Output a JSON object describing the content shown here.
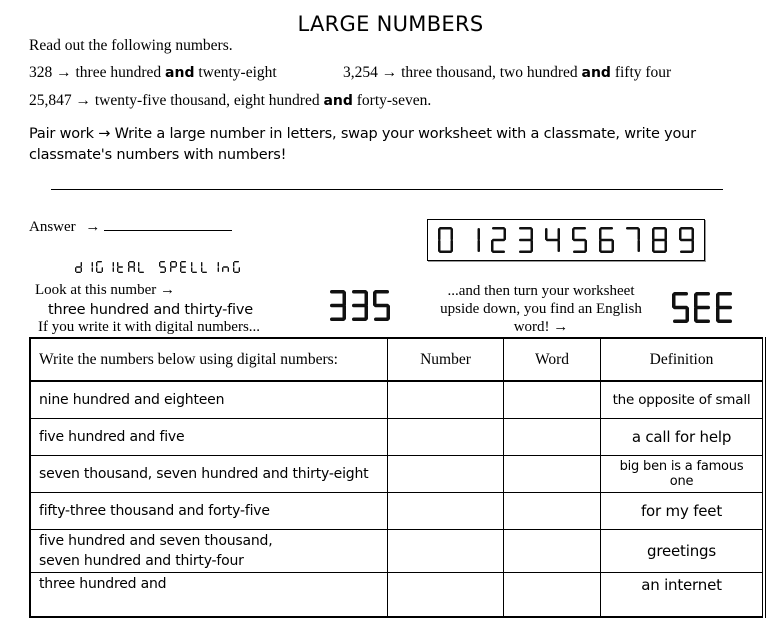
{
  "title": "LARGE NUMBERS",
  "intro": "Read out the following numbers.",
  "examples": [
    {
      "number": "328",
      "before": "three hundred",
      "and": "and",
      "after": "twenty-eight"
    },
    {
      "number": "3,254",
      "before": "three thousand, two hundred",
      "and": "and",
      "after": "fifty four"
    },
    {
      "number": "25,847",
      "before": "twenty-five thousand, eight hundred",
      "and": "and",
      "after": "forty-seven."
    }
  ],
  "arrow": "→",
  "pair_work": {
    "label": "Pair work",
    "text": "Write a large number in letters, swap your worksheet with a classmate, write your classmate's numbers with numbers!"
  },
  "answer_label": "Answer",
  "digit_strip": "0123456789",
  "digital_spelling": {
    "title": "DIGITAL SPELLING",
    "look": "Look at this number",
    "words": "three hundred and thirty-five",
    "if_write": "If you write it with digital numbers...",
    "example_number": "335",
    "then_turn": "...and then turn your worksheet upside down, you find an English word!",
    "result_word": "SEE"
  },
  "table": {
    "headers": [
      "Write the numbers below using digital numbers:",
      "Number",
      "Word",
      "Definition"
    ],
    "rows": [
      {
        "prompt": "nine hundred and eighteen",
        "number": "",
        "word": "",
        "definition": "the opposite of small"
      },
      {
        "prompt": "five hundred and five",
        "number": "",
        "word": "",
        "definition": "a call for help"
      },
      {
        "prompt": "seven thousand, seven hundred and thirty-eight",
        "number": "",
        "word": "",
        "definition": "big ben is a famous one"
      },
      {
        "prompt": "fifty-three thousand and forty-five",
        "number": "",
        "word": "",
        "definition": "for my feet"
      },
      {
        "prompt_line1": "five hundred and seven thousand,",
        "prompt_line2": "seven hundred and thirty-four",
        "number": "",
        "word": "",
        "definition": "greetings"
      },
      {
        "prompt": "three hundred and",
        "number": "",
        "word": "",
        "definition": "an internet"
      }
    ]
  }
}
